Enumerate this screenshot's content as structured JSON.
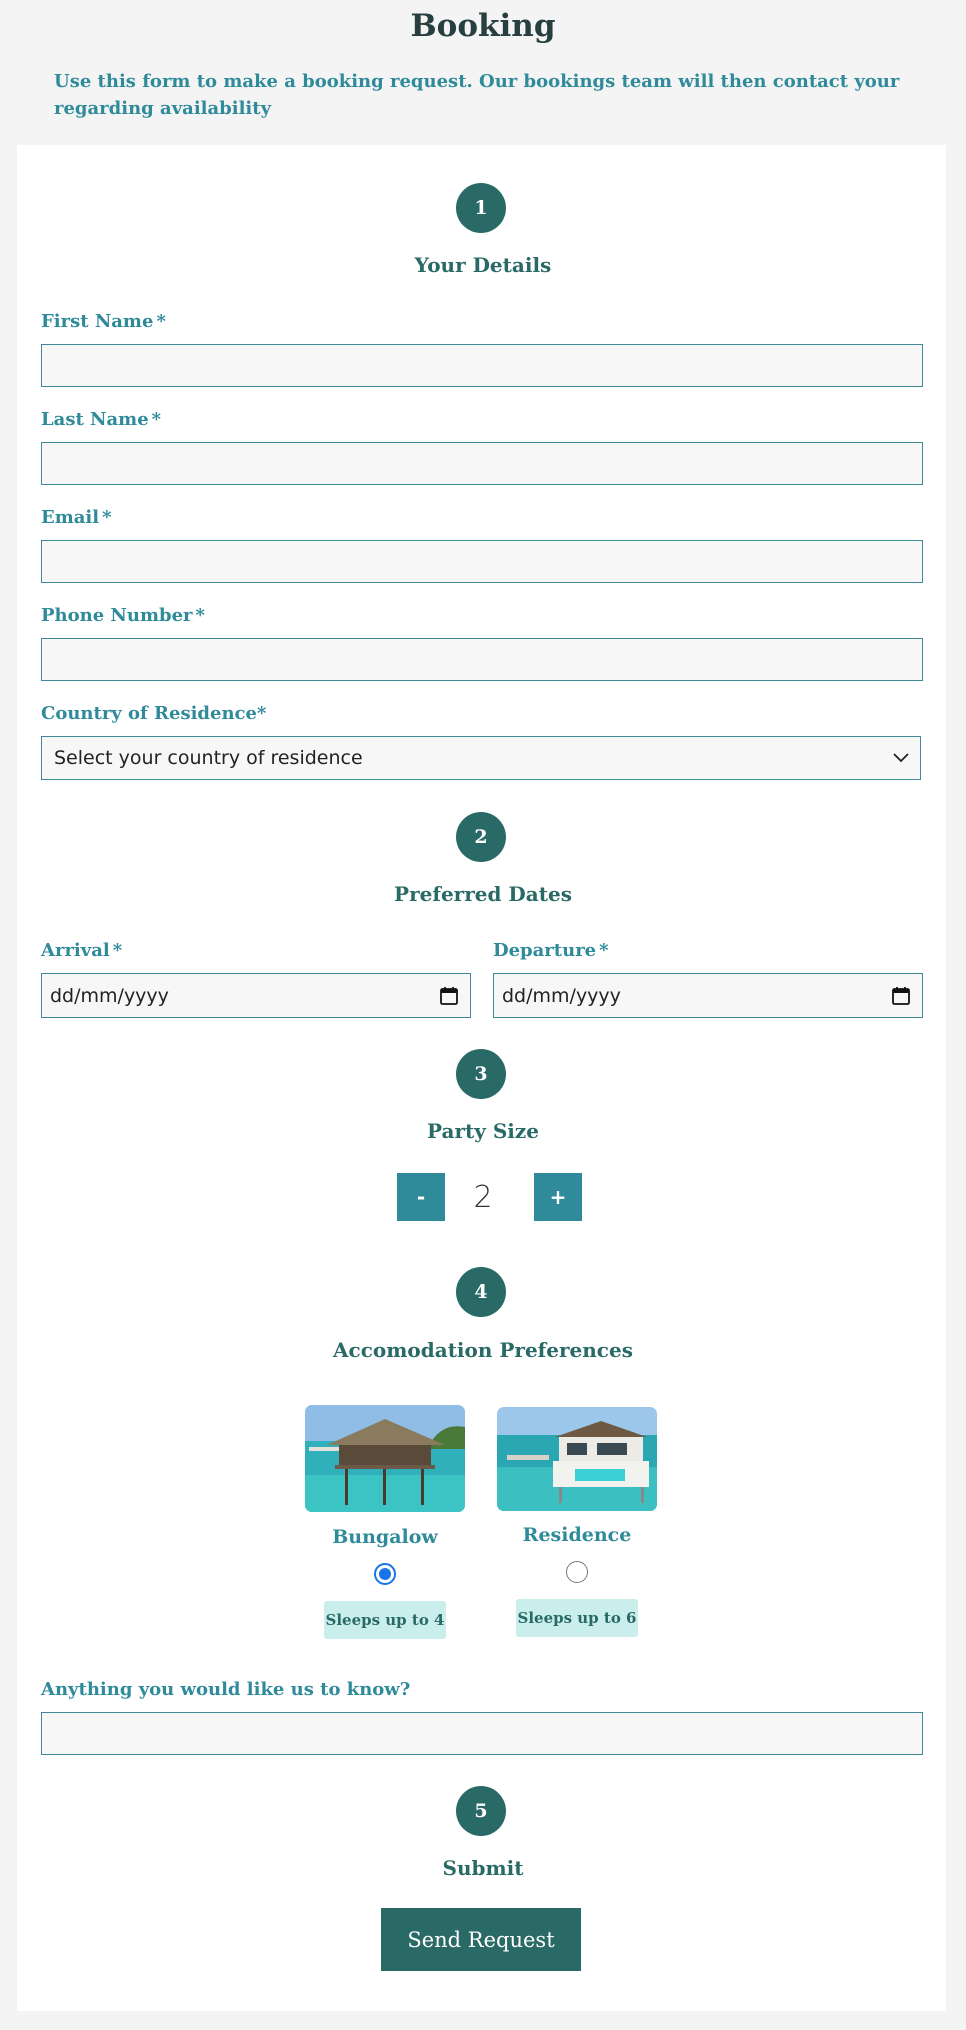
{
  "page": {
    "title": "Booking",
    "intro": "Use this form to make a booking request. Our bookings team will then contact your regarding availability"
  },
  "steps": [
    {
      "number": "1",
      "title": "Your Details"
    },
    {
      "number": "2",
      "title": "Preferred Dates"
    },
    {
      "number": "3",
      "title": "Party Size"
    },
    {
      "number": "4",
      "title": "Accomodation Preferences"
    },
    {
      "number": "5",
      "title": "Submit"
    }
  ],
  "details": {
    "required_mark": "*",
    "first_name": {
      "label": "First Name",
      "value": ""
    },
    "last_name": {
      "label": "Last Name",
      "value": ""
    },
    "email": {
      "label": "Email",
      "value": ""
    },
    "phone": {
      "label": "Phone Number",
      "value": ""
    },
    "country": {
      "label": "Country of Residence",
      "selected": "Select your country of residence"
    }
  },
  "dates": {
    "arrival": {
      "label": "Arrival",
      "placeholder": "dd/mm/yyyy"
    },
    "departure": {
      "label": "Departure",
      "placeholder": "dd/mm/yyyy"
    }
  },
  "party": {
    "minus_label": "-",
    "plus_label": "+",
    "value": "2"
  },
  "accommodation": [
    {
      "name": "Bungalow",
      "badge": "Sleeps up to 4",
      "selected": true
    },
    {
      "name": "Residence",
      "badge": "Sleeps up to 6",
      "selected": false
    }
  ],
  "notes": {
    "label": "Anything you would like us to know?",
    "value": ""
  },
  "submit": {
    "button_label": "Send Request"
  },
  "colors": {
    "primary": "#2a6a66",
    "accent": "#2f8a9a",
    "badge_bg": "#c9eeeb",
    "page_bg": "#f4f4f5"
  },
  "icons": {
    "select": "chevron-down-icon",
    "date": "calendar-icon"
  }
}
